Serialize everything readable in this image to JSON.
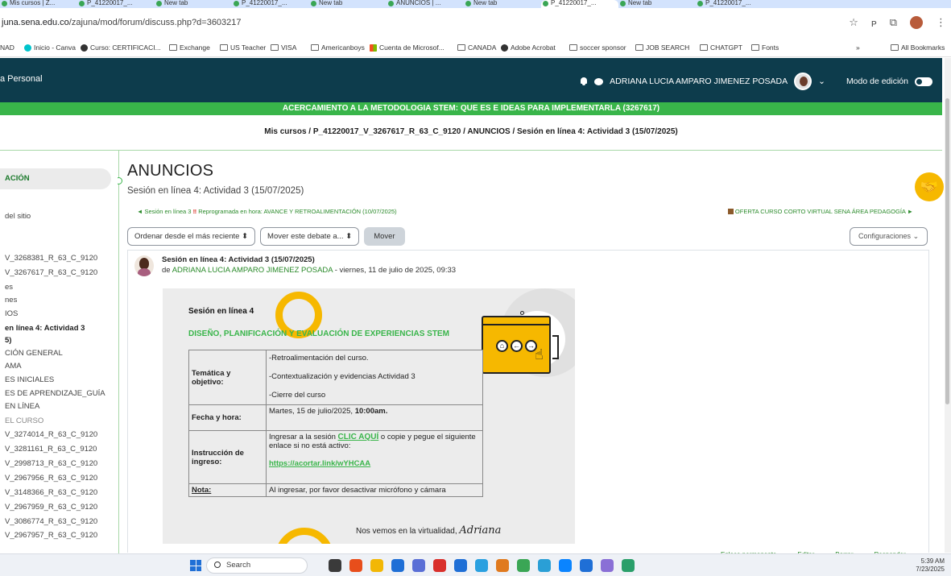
{
  "browser": {
    "url_host": "juna.sena.edu.co",
    "url_path": "/zajuna/mod/forum/discuss.php?d=3603217",
    "tabs": [
      "Mis cursos | Z...",
      "P_41220017_...",
      "New tab",
      "P_41220017_...",
      "New tab",
      "ANUNCIOS | ...",
      "New tab",
      "P_41220017_...",
      "New tab",
      "P_41220017_..."
    ],
    "bookmarks": [
      {
        "label": "NAD",
        "icon": "none"
      },
      {
        "label": "Inicio - Canva",
        "icon": "canva"
      },
      {
        "label": "Curso: CERTIFICACI...",
        "icon": "round"
      },
      {
        "label": "Exchange",
        "icon": "folder"
      },
      {
        "label": "US Teacher",
        "icon": "folder"
      },
      {
        "label": "VISA",
        "icon": "folder"
      },
      {
        "label": "Americanboys",
        "icon": "folder"
      },
      {
        "label": "Cuenta de Microsof...",
        "icon": "ms"
      },
      {
        "label": "CANADA",
        "icon": "folder"
      },
      {
        "label": "Adobe Acrobat",
        "icon": "adobe"
      },
      {
        "label": "soccer sponsor",
        "icon": "folder"
      },
      {
        "label": "JOB SEARCH",
        "icon": "folder"
      },
      {
        "label": "CHATGPT",
        "icon": "folder"
      },
      {
        "label": "Fonts",
        "icon": "folder"
      }
    ],
    "more": "»",
    "all_bookmarks": "All Bookmarks"
  },
  "navbar": {
    "brand": "a Personal",
    "user_name": "ADRIANA LUCIA AMPARO JIMENEZ POSADA",
    "edit_mode": "Modo de edición"
  },
  "course_title": "ACERCAMIENTO A LA METODOLOGIA STEM: QUE ES E IDEAS PARA IMPLEMENTARLA (3267617)",
  "breadcrumb": "Mis cursos / P_41220017_V_3267617_R_63_C_9120 / ANUNCIOS / Sesión en línea 4: Actividad 3 (15/07/2025)",
  "sidebar": {
    "heading": "ACIÓN",
    "items": [
      {
        "label": "del sitio",
        "style": "normal"
      },
      {
        "label": "V_3268381_R_63_C_9120",
        "style": "normal"
      },
      {
        "label": "V_3267617_R_63_C_9120",
        "style": "normal"
      },
      {
        "label": "es",
        "style": "normal"
      },
      {
        "label": "nes",
        "style": "normal"
      },
      {
        "label": "IOS",
        "style": "normal"
      },
      {
        "label": "en línea 4: Actividad 3",
        "style": "bold"
      },
      {
        "label": "5)",
        "style": "bold"
      },
      {
        "label": "CIÓN GENERAL",
        "style": "normal"
      },
      {
        "label": "AMA",
        "style": "normal"
      },
      {
        "label": "ES INICIALES",
        "style": "normal"
      },
      {
        "label": "ES DE APRENDIZAJE_GUÍA",
        "style": "normal"
      },
      {
        "label": "EN LÍNEA",
        "style": "normal"
      },
      {
        "label": "EL CURSO",
        "style": "grey"
      },
      {
        "label": "V_3274014_R_63_C_9120",
        "style": "normal"
      },
      {
        "label": "V_3281161_R_63_C_9120",
        "style": "normal"
      },
      {
        "label": "V_2998713_R_63_C_9120",
        "style": "normal"
      },
      {
        "label": "V_2967956_R_63_C_9120",
        "style": "normal"
      },
      {
        "label": "V_3148366_R_63_C_9120",
        "style": "normal"
      },
      {
        "label": "V_2967959_R_63_C_9120",
        "style": "normal"
      },
      {
        "label": "V_3086774_R_63_C_9120",
        "style": "normal"
      },
      {
        "label": "V_2967957_R_63_C_9120",
        "style": "normal"
      }
    ]
  },
  "main": {
    "title": "ANUNCIOS",
    "subtitle": "Sesión en línea 4: Actividad 3 (15/07/2025)",
    "prev_link_prefix": "◄ Sesión en línea 3",
    "prev_link_warn": "‼",
    "prev_link_rest": "Reprogramada en hora: AVANCE Y RETROALIMENTACIÓN (10/07/2025)",
    "next_link": "OFERTA CURSO CORTO VIRTUAL SENA ÁREA PEDAGOGÍA ►",
    "sort_select": "Ordenar desde el más reciente",
    "move_select": "Mover este debate a...",
    "move_button": "Mover",
    "settings": "Configuraciones"
  },
  "post": {
    "title": "Sesión en línea 4: Actividad 3 (15/07/2025)",
    "by": "de",
    "author": "ADRIANA LUCIA AMPARO JIMENEZ POSADA",
    "date": " - viernes, 11 de julio de 2025, 09:33"
  },
  "flyer": {
    "heading": "Sesión en línea 4",
    "subheading": "DISEÑO, PLANIFICACIÓN Y EVALUACIÓN DE EXPERIENCIAS STEM",
    "row1_label": "Temática y objetivo:",
    "row1_lines": [
      "-Retroalimentación del curso.",
      "-Contextualización y evidencias Actividad 3",
      "-Cierre del curso"
    ],
    "row2_label": "Fecha y hora:",
    "row2_value_prefix": "Martes, 15 de julio/2025, ",
    "row2_value_bold": "10:00am.",
    "row3_label": "Instrucción de ingreso:",
    "row3_before": "Ingresar a la sesión ",
    "row3_link": "CLIC AQUÍ",
    "row3_after": " o copie y pegue el siguiente enlace si no está activo:",
    "row3_url": "https://acortar.link/wYHCAA",
    "row4_label": "Nota:",
    "row4_value": "Al ingresar, por favor desactivar micrófono y cámara",
    "footer": "Nos vemos en la virtualidad,",
    "signature": "Adriana"
  },
  "post_footer": [
    "Enlace permanente",
    "Editar",
    "Borrar",
    "Responder"
  ],
  "taskbar": {
    "search": "Search",
    "time": "5:39 AM",
    "date": "7/23/2025"
  },
  "colors": {
    "navbar": "#0d3c4c",
    "accent_green": "#39b54a",
    "accent_yellow": "#f6b800"
  }
}
